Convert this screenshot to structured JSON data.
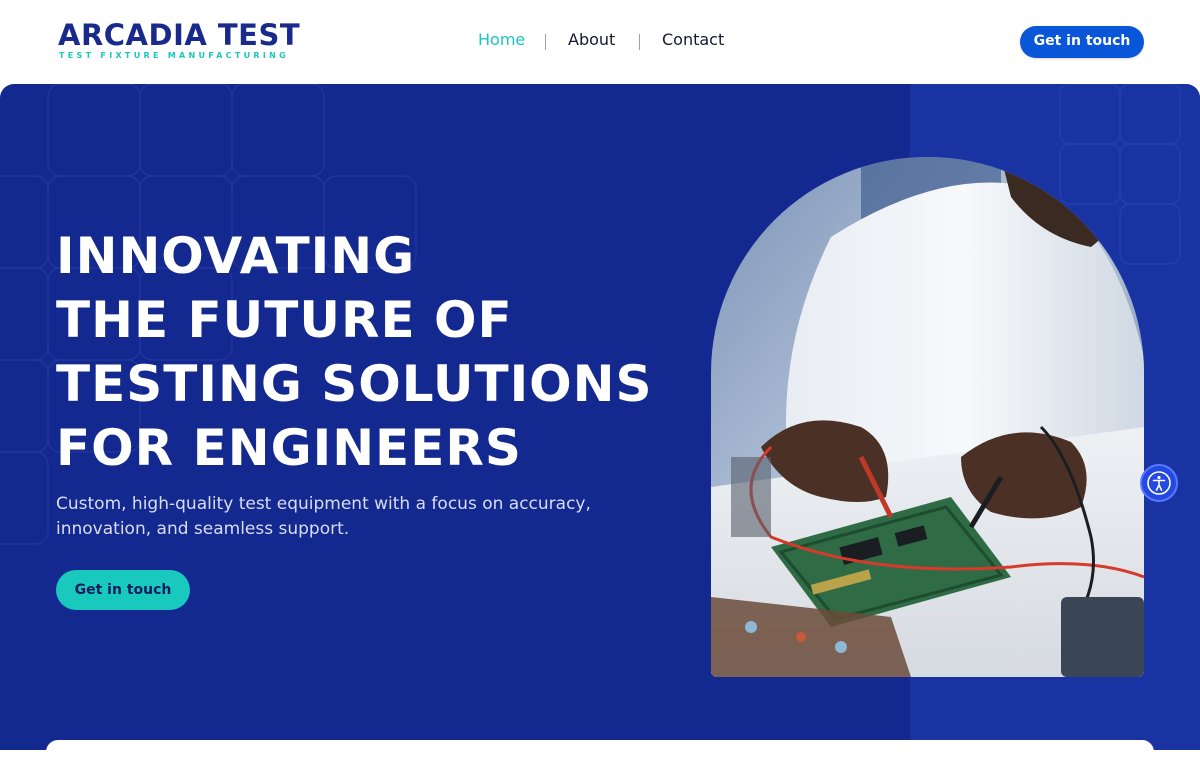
{
  "header": {
    "logo": {
      "main": "ARCADIA TEST",
      "sub": "TEST FIXTURE MANUFACTURING"
    },
    "nav": [
      {
        "label": "Home",
        "active": true
      },
      {
        "label": "About",
        "active": false
      },
      {
        "label": "Contact",
        "active": false
      }
    ],
    "cta_label": "Get in touch"
  },
  "hero": {
    "title_lines": [
      "INNOVATING",
      "THE FUTURE OF",
      "TESTING SOLUTIONS",
      "FOR ENGINEERS"
    ],
    "subtitle": "Custom, high-quality test equipment with a focus on accuracy, innovation, and seamless support.",
    "cta_label": "Get in touch"
  },
  "accessibility": {
    "icon": "accessibility-icon"
  },
  "colors": {
    "brand_navy": "#1a2a8c",
    "accent_teal": "#1bc6c1",
    "hero_bg": "#14298f",
    "header_button": "#0a56d9",
    "hero_button": "#19c9bd"
  }
}
